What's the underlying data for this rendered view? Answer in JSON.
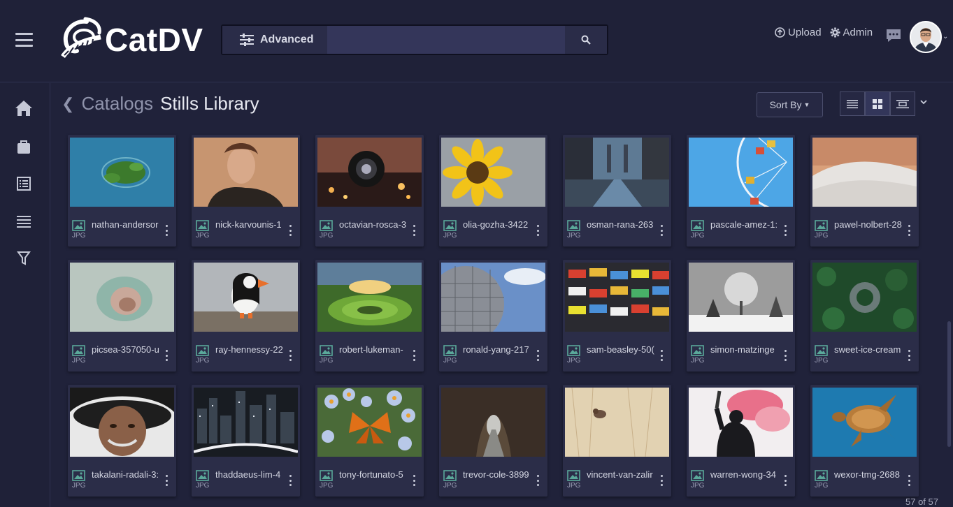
{
  "header": {
    "brand": "CatDV",
    "advanced_label": "Advanced",
    "search_placeholder": "",
    "upload_label": "Upload",
    "admin_label": "Admin"
  },
  "sidebar": {
    "items": [
      {
        "icon": "home-icon"
      },
      {
        "icon": "briefcase-icon"
      },
      {
        "icon": "list-detail-icon"
      },
      {
        "icon": "lines-icon"
      },
      {
        "icon": "filter-icon"
      }
    ]
  },
  "breadcrumb": {
    "parent": "Catalogs",
    "current": "Stills Library"
  },
  "toolbar": {
    "sort_label": "Sort By"
  },
  "items": [
    {
      "name": "nathan-andersor",
      "type": "JPG",
      "thumb": "island"
    },
    {
      "name": "nick-karvounis-1",
      "type": "JPG",
      "thumb": "portrait"
    },
    {
      "name": "octavian-rosca-3",
      "type": "JPG",
      "thumb": "lens"
    },
    {
      "name": "olia-gozha-3422",
      "type": "JPG",
      "thumb": "sunflower"
    },
    {
      "name": "osman-rana-263",
      "type": "JPG",
      "thumb": "bridge"
    },
    {
      "name": "pascale-amez-1:",
      "type": "JPG",
      "thumb": "ferris"
    },
    {
      "name": "pawel-nolbert-28",
      "type": "JPG",
      "thumb": "dune"
    },
    {
      "name": "picsea-357050-u",
      "type": "JPG",
      "thumb": "ice"
    },
    {
      "name": "ray-hennessy-22",
      "type": "JPG",
      "thumb": "puffin"
    },
    {
      "name": "robert-lukeman-",
      "type": "JPG",
      "thumb": "field"
    },
    {
      "name": "ronald-yang-217",
      "type": "JPG",
      "thumb": "sphere"
    },
    {
      "name": "sam-beasley-50(",
      "type": "JPG",
      "thumb": "market"
    },
    {
      "name": "simon-matzinge",
      "type": "JPG",
      "thumb": "trees"
    },
    {
      "name": "sweet-ice-cream",
      "type": "JPG",
      "thumb": "forest"
    },
    {
      "name": "takalani-radali-3:",
      "type": "JPG",
      "thumb": "oldman"
    },
    {
      "name": "thaddaeus-lim-4",
      "type": "JPG",
      "thumb": "city"
    },
    {
      "name": "tony-fortunato-5",
      "type": "JPG",
      "thumb": "butterfly"
    },
    {
      "name": "trevor-cole-3899",
      "type": "JPG",
      "thumb": "tunnel"
    },
    {
      "name": "vincent-van-zalir",
      "type": "JPG",
      "thumb": "bird"
    },
    {
      "name": "warren-wong-34",
      "type": "JPG",
      "thumb": "smoke"
    },
    {
      "name": "wexor-tmg-2688",
      "type": "JPG",
      "thumb": "turtle"
    }
  ],
  "status": {
    "count_label": "57 of 57"
  }
}
